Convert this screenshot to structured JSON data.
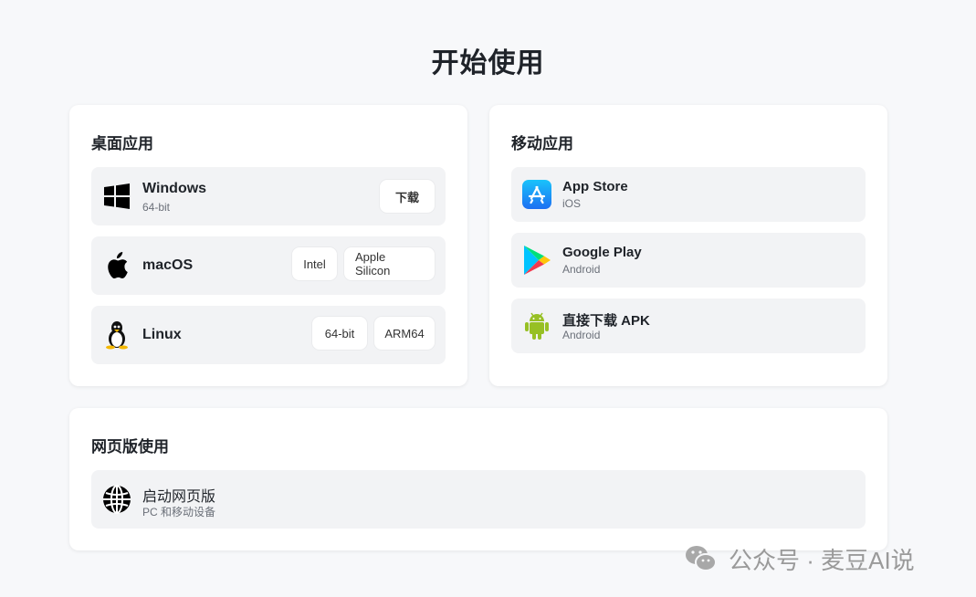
{
  "page": {
    "title": "开始使用"
  },
  "desktop": {
    "title": "桌面应用",
    "windows": {
      "name": "Windows",
      "sub": "64-bit",
      "download": "下载"
    },
    "macos": {
      "name": "macOS",
      "intel": "Intel",
      "apple_silicon": "Apple Silicon"
    },
    "linux": {
      "name": "Linux",
      "x64": "64-bit",
      "arm64": "ARM64"
    }
  },
  "mobile": {
    "title": "移动应用",
    "appstore": {
      "name": "App Store",
      "sub": "iOS"
    },
    "googleplay": {
      "name": "Google Play",
      "sub": "Android"
    },
    "apk": {
      "name": "直接下载 APK",
      "sub": "Android"
    }
  },
  "web": {
    "title": "网页版使用",
    "launch": {
      "name": "启动网页版",
      "sub": "PC 和移动设备"
    }
  },
  "watermark": {
    "text": "公众号 · 麦豆AI说"
  },
  "icons": {
    "windows": "windows-logo-icon",
    "apple": "apple-logo-icon",
    "linux": "linux-penguin-icon",
    "appstore": "app-store-icon",
    "googleplay": "google-play-icon",
    "android": "android-robot-icon",
    "globe": "globe-icon",
    "wechat": "wechat-icon"
  },
  "colors": {
    "background": "#f7f8fa",
    "card": "#ffffff",
    "row": "#f2f3f5",
    "appstore_blue": "#1a8cf5",
    "android_green": "#97c024"
  }
}
